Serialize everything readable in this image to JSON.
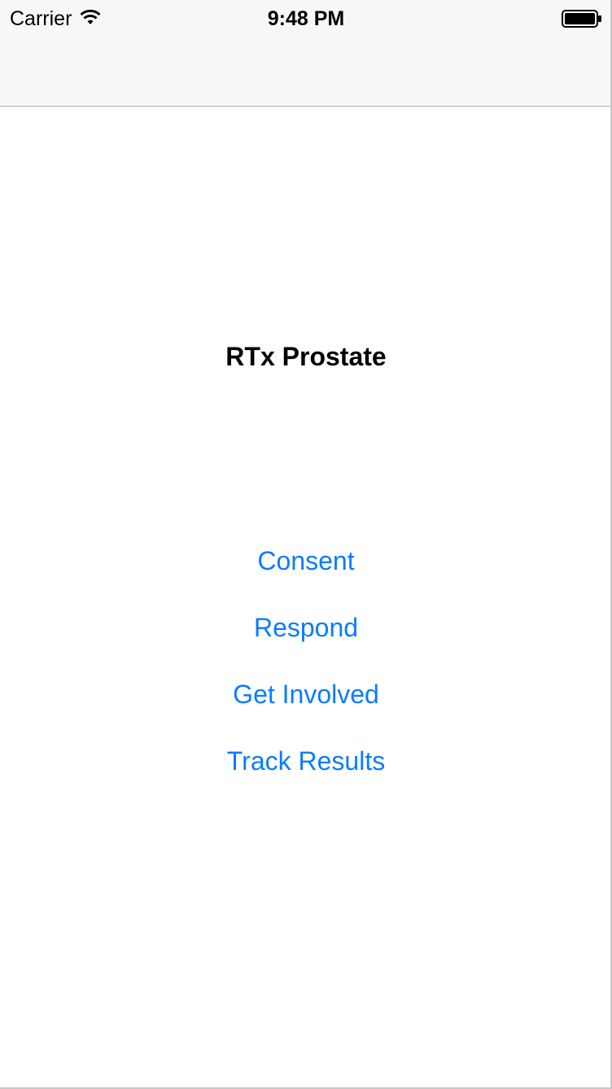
{
  "status_bar": {
    "carrier": "Carrier",
    "time": "9:48 PM",
    "wifi_icon": "wifi-icon",
    "battery_icon": "battery-full-icon"
  },
  "main": {
    "title": "RTx Prostate",
    "menu": [
      {
        "label": "Consent"
      },
      {
        "label": "Respond"
      },
      {
        "label": "Get Involved"
      },
      {
        "label": "Track Results"
      }
    ]
  },
  "colors": {
    "link": "#0a7cff",
    "nav_background": "#f7f7f7",
    "separator": "#b2b2b2"
  }
}
